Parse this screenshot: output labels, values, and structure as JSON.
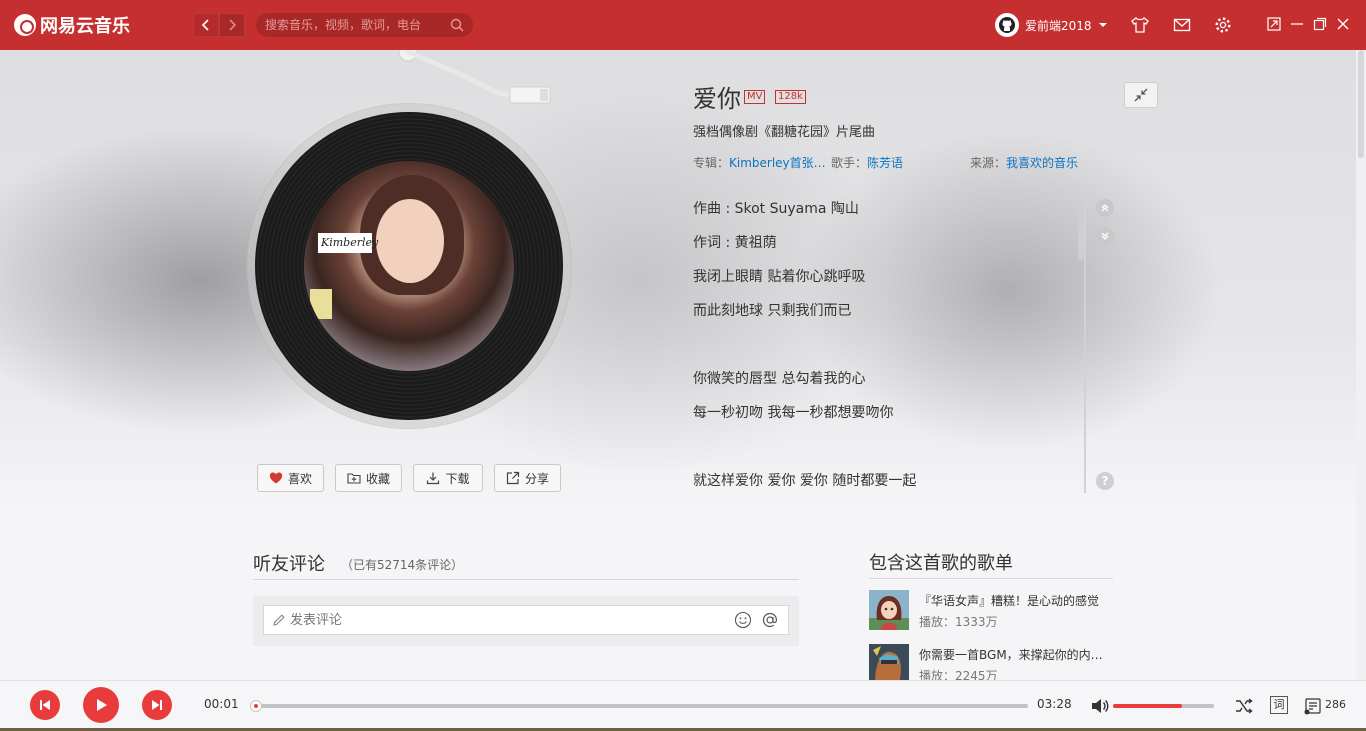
{
  "app": {
    "logo_text": "网易云音乐",
    "accent": "#c62f2f"
  },
  "search": {
    "placeholder": "搜索音乐，视频，歌词，电台"
  },
  "user": {
    "name": "爱前端2018"
  },
  "song": {
    "title": "爱你",
    "tag_mv": "MV",
    "tag_quality": "128k",
    "subtitle": "强档偶像剧《翻糖花园》片尾曲",
    "album_label": "专辑：",
    "album": "Kimberley首张…",
    "artist_label": "歌手：",
    "artist": "陈芳语",
    "source_label": "来源：",
    "source": "我喜欢的音乐",
    "cover_text": "Kimberley"
  },
  "actions": {
    "like": "喜欢",
    "collect": "收藏",
    "download": "下载",
    "share": "分享"
  },
  "lyrics": [
    "作曲 : Skot Suyama 陶山",
    "作词 : 黄祖荫",
    "我闭上眼睛 贴着你心跳呼吸",
    "而此刻地球 只剩我们而已",
    "你微笑的唇型 总勾着我的心",
    "每一秒初吻 我每一秒都想要吻你",
    "就这样爱你 爱你 爱你 随时都要一起"
  ],
  "comments": {
    "title": "听友评论",
    "count_text": "（已有52714条评论）",
    "placeholder": "发表评论"
  },
  "playlists": {
    "title": "包含这首歌的歌单",
    "items": [
      {
        "name": "『华语女声』糟糕！是心动的感觉",
        "plays": "播放：1333万"
      },
      {
        "name": "你需要一首BGM，来撑起你的内…",
        "plays": "播放：2245万"
      }
    ]
  },
  "player": {
    "current_time": "00:01",
    "total_time": "03:28",
    "progress_fraction": 0.005,
    "volume_fraction": 0.68,
    "lyric_toggle": "词",
    "queue_count": "286"
  }
}
